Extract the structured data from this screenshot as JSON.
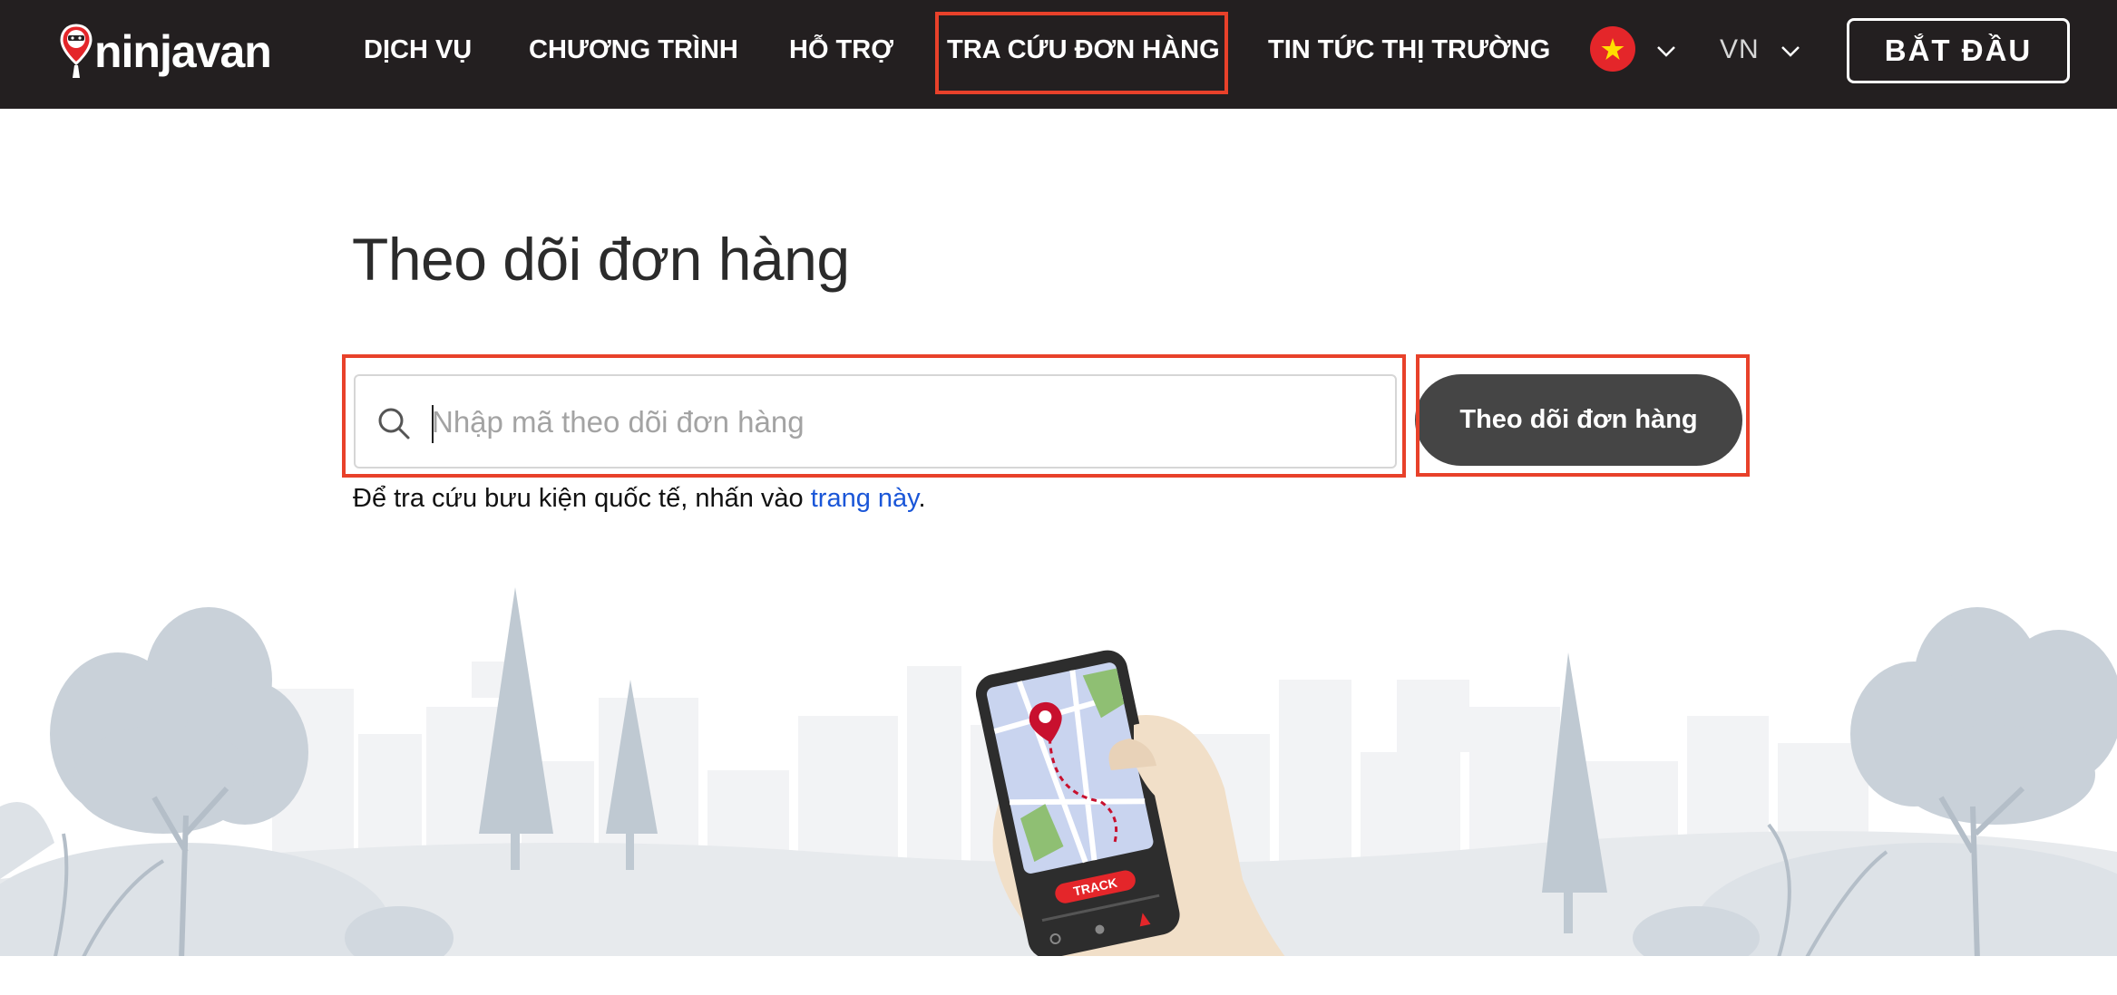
{
  "header": {
    "logo_text": "ninjavan",
    "nav": [
      {
        "label": "DỊCH VỤ"
      },
      {
        "label": "CHƯƠNG TRÌNH"
      },
      {
        "label": "HỖ TRỢ"
      },
      {
        "label": "TRA CỨU ĐƠN HÀNG",
        "active": true
      },
      {
        "label": "TIN TỨC THỊ TRƯỜNG"
      }
    ],
    "country_flag_icon": "vietnam-flag-icon",
    "language": "VN",
    "cta_label": "BẮT ĐẦU"
  },
  "main": {
    "title": "Theo dõi đơn hàng",
    "search": {
      "placeholder": "Nhập mã theo dõi đơn hàng",
      "value": ""
    },
    "track_button_label": "Theo dõi đơn hàng",
    "helper_prefix": "Để tra cứu bưu kiện quốc tế, nhấn vào ",
    "helper_link": "trang này",
    "helper_suffix": "."
  },
  "illustration": {
    "phone_button_label": "TRACK"
  },
  "colors": {
    "header_bg": "#231f20",
    "highlight": "#e8412a",
    "button_bg": "#454545",
    "link": "#1a56d8",
    "brand_red": "#c8102e"
  }
}
